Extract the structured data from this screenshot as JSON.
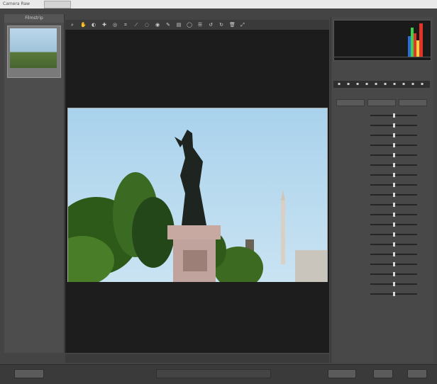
{
  "window": {
    "title": "Camera Raw",
    "tab": ""
  },
  "filmstrip": {
    "header": "Filmstrip",
    "thumb_label": ""
  },
  "toolbar": {
    "tools": [
      "zoom-icon",
      "hand-icon",
      "white-balance-icon",
      "color-sampler-icon",
      "target-icon",
      "crop-icon",
      "straighten-icon",
      "spot-icon",
      "redeye-icon",
      "brush-icon",
      "graduated-icon",
      "radial-icon",
      "preferences-icon",
      "rotate-left-icon",
      "rotate-right-icon",
      "trash-icon",
      "fullscreen-icon"
    ]
  },
  "preview": {
    "zoom": "",
    "filename": "",
    "status": ""
  },
  "histogram": {
    "colors": [
      "#2a6cd8",
      "#3cd24a",
      "#e4342a",
      "#f0d23a"
    ]
  },
  "panel": {
    "readout": {
      "rgb": "",
      "camera": ""
    },
    "tabs": [
      "basic-icon",
      "tone-curve-icon",
      "detail-icon",
      "hsl-icon",
      "split-toning-icon",
      "lens-icon",
      "effects-icon",
      "calibration-icon",
      "presets-icon",
      "snapshots-icon"
    ],
    "buttons": [
      "",
      "",
      ""
    ],
    "controls": [
      "",
      "",
      "",
      "",
      "",
      "",
      "",
      "",
      "",
      "",
      "",
      "",
      "",
      "",
      "",
      "",
      "",
      "",
      ""
    ]
  },
  "bottom": {
    "save": "",
    "workflow": "",
    "open": "",
    "cancel": "",
    "done": ""
  }
}
